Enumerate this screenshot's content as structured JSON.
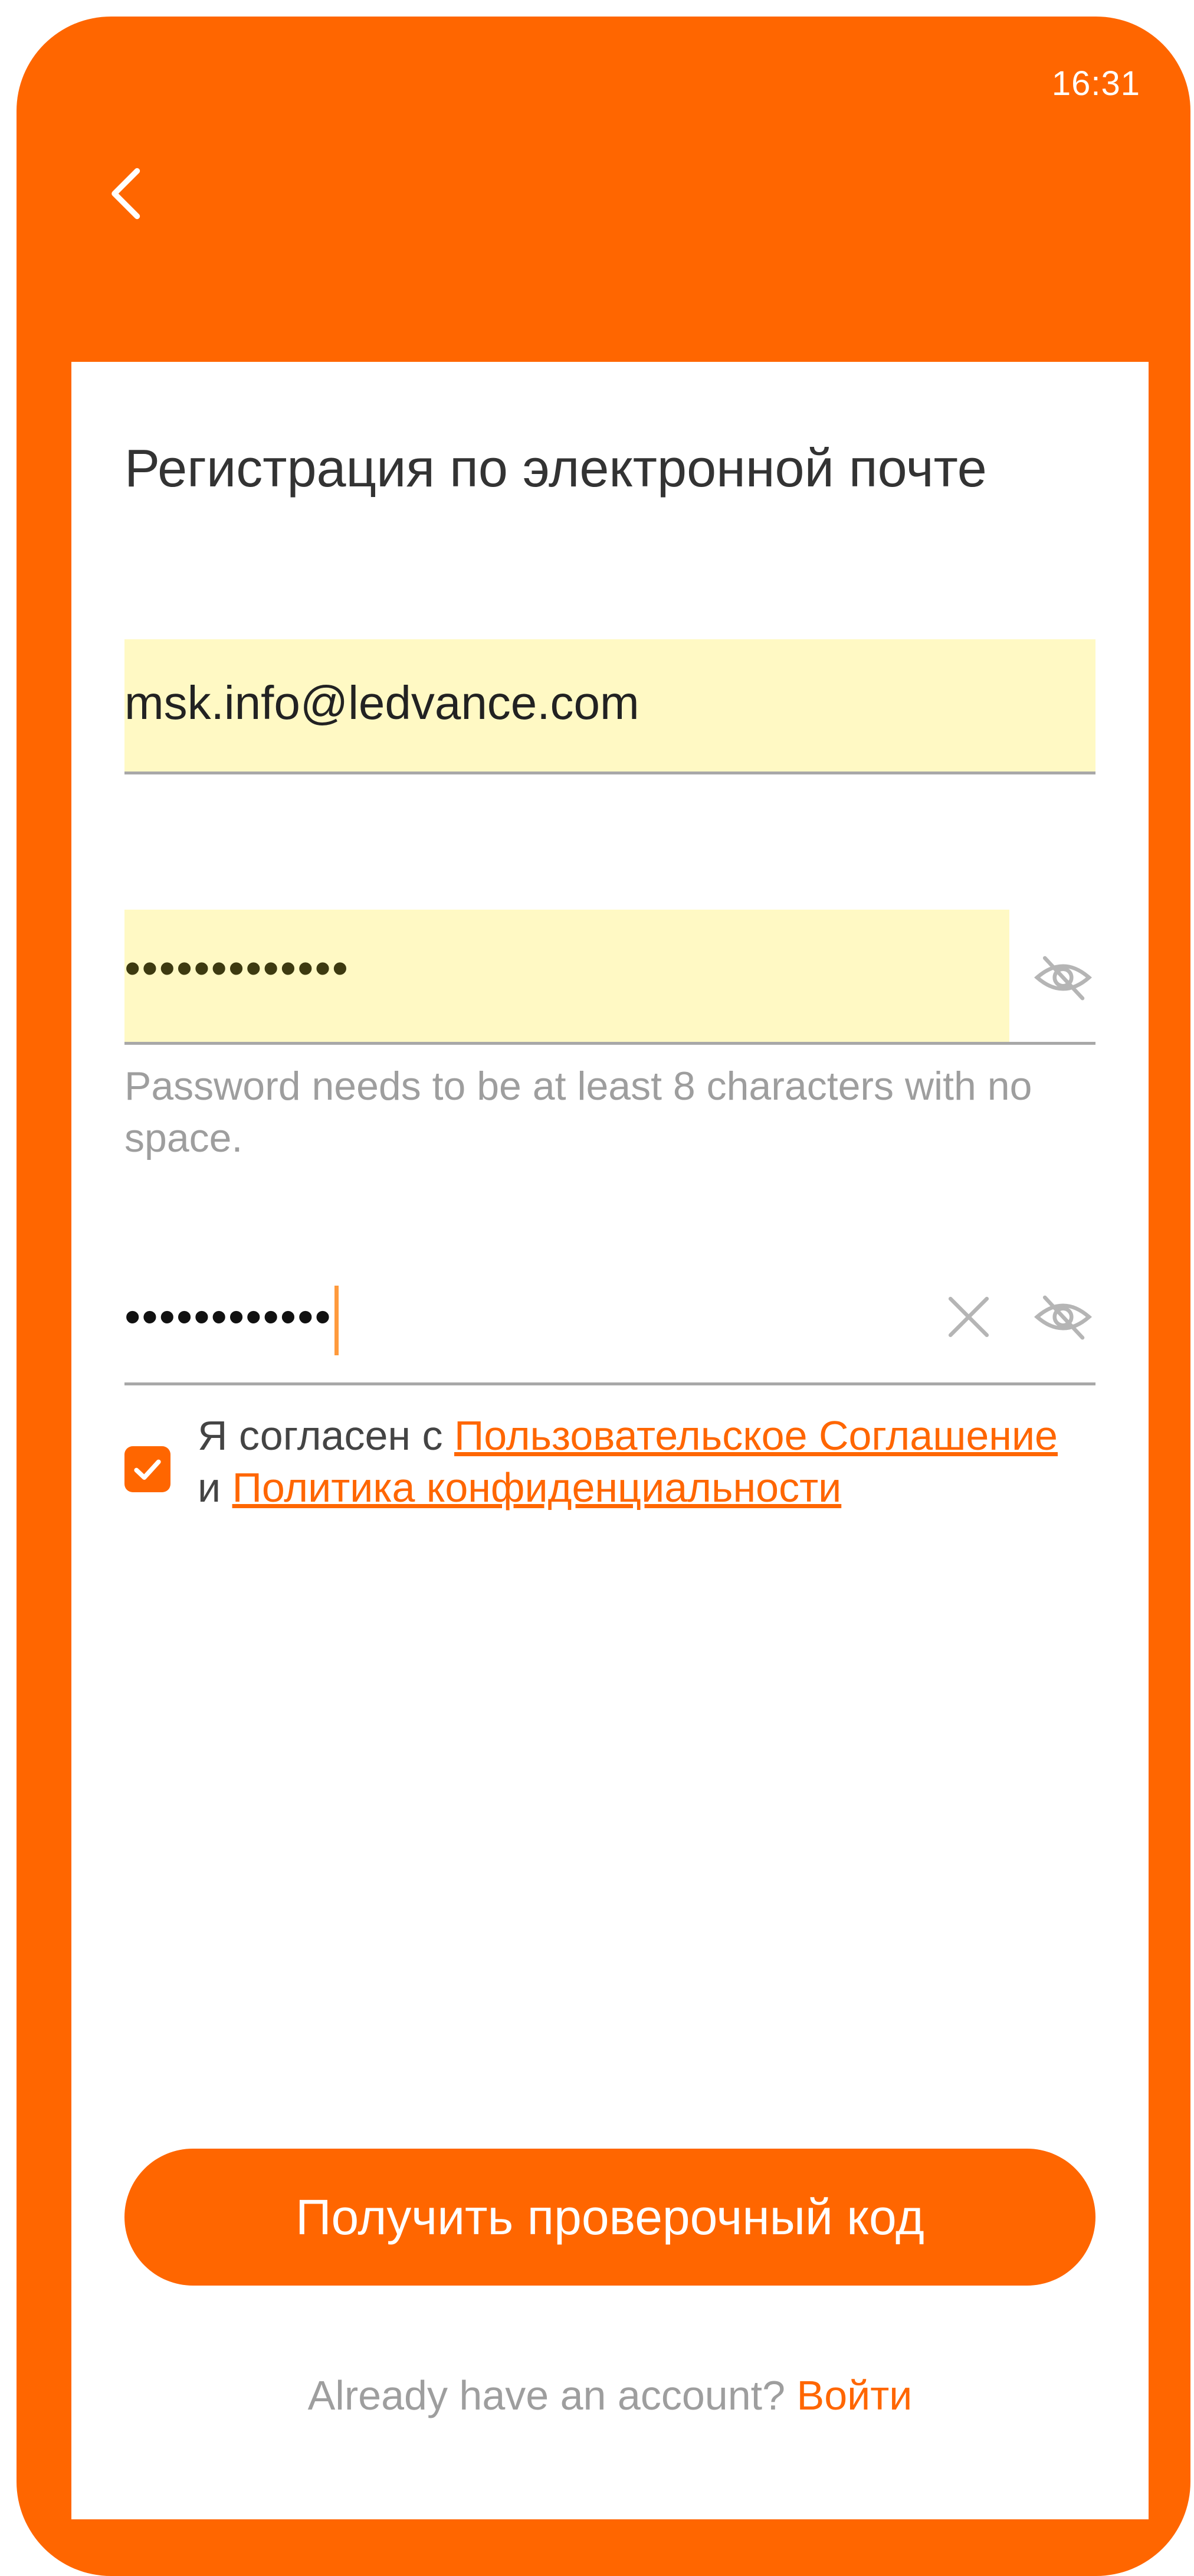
{
  "status_bar": {
    "time": "16:31"
  },
  "header": {
    "back_icon": "chevron-left-icon"
  },
  "page": {
    "title": "Регистрация по электронной почте"
  },
  "form": {
    "email": {
      "value": "msk.info@ledvance.com"
    },
    "password": {
      "value_masked": "•••••••••••••",
      "visibility_icon": "eye-off-icon"
    },
    "password_hint": "Password needs to be at least 8 characters with no space.",
    "confirm_password": {
      "value_masked": "••••••••••••",
      "clear_icon": "close-icon",
      "visibility_icon": "eye-off-icon"
    }
  },
  "agreement": {
    "checked": true,
    "prefix": "Я согласен с ",
    "terms_link": "Пользовательское Соглашение",
    "conjunction": "и ",
    "privacy_link": "Политика конфиденциальности"
  },
  "actions": {
    "get_code_label": "Получить проверочный код",
    "have_account_text": "Already have an account? ",
    "login_link": "Войти"
  },
  "colors": {
    "accent": "#ff6600",
    "autofill": "#fff9c4",
    "hint_text": "#9e9e9e",
    "divider": "#a8a8a8"
  }
}
